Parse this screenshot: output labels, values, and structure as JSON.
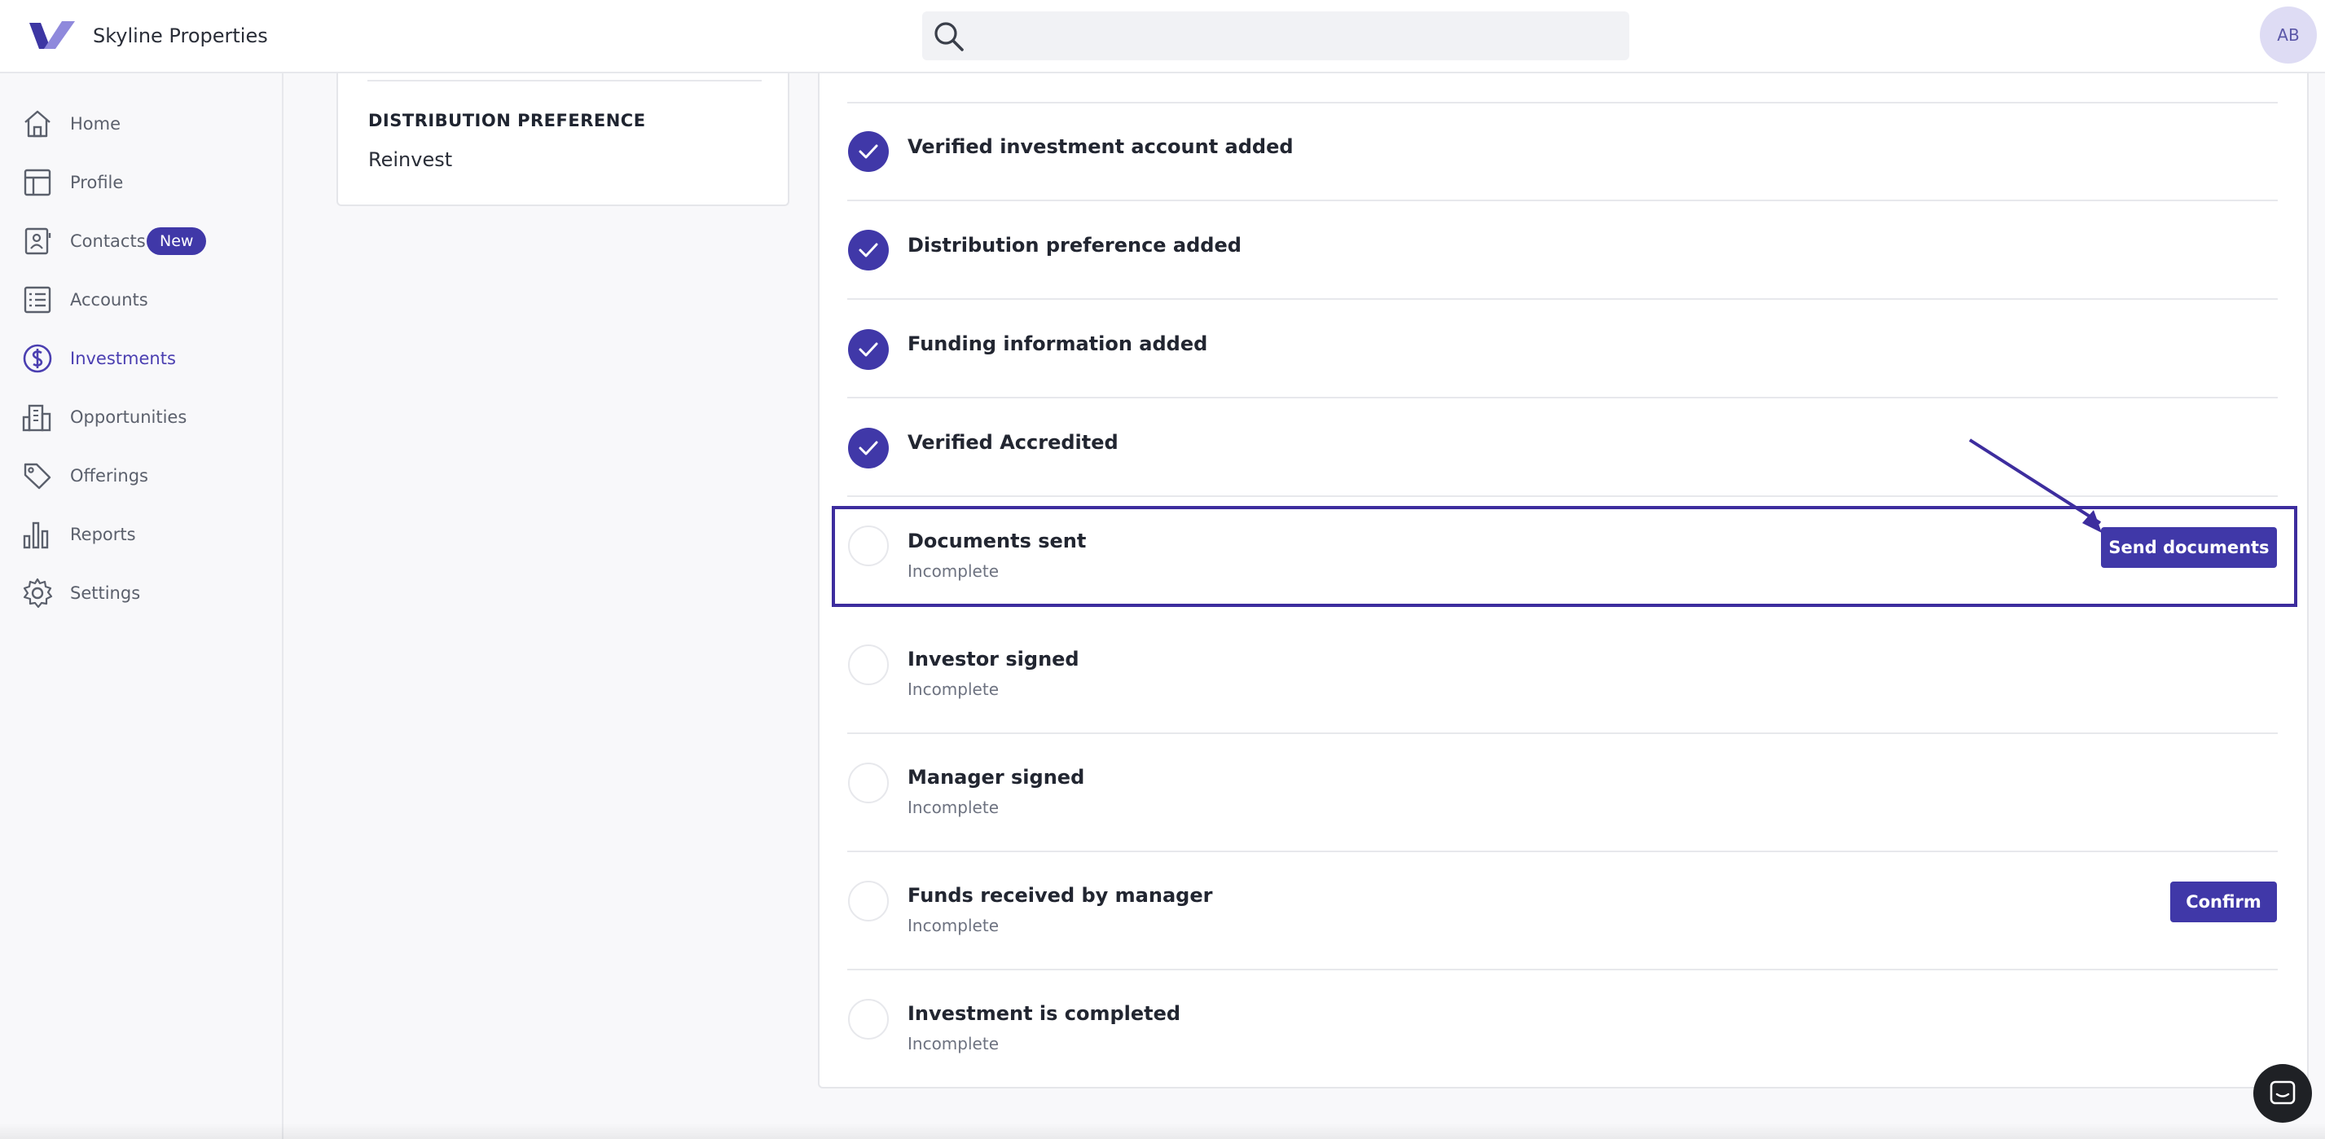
{
  "header": {
    "company_name": "Skyline Properties",
    "search_placeholder": "",
    "avatar_initials": "AB"
  },
  "sidebar": {
    "items": [
      {
        "label": "Home",
        "icon": "home-icon"
      },
      {
        "label": "Profile",
        "icon": "profile-icon"
      },
      {
        "label": "Contacts",
        "icon": "contacts-icon",
        "badge": "New"
      },
      {
        "label": "Accounts",
        "icon": "accounts-icon"
      },
      {
        "label": "Investments",
        "icon": "dollar-icon",
        "active": true
      },
      {
        "label": "Opportunities",
        "icon": "building-icon"
      },
      {
        "label": "Offerings",
        "icon": "tag-icon"
      },
      {
        "label": "Reports",
        "icon": "bar-chart-icon"
      },
      {
        "label": "Settings",
        "icon": "gear-icon"
      }
    ]
  },
  "left_card": {
    "distribution_title": "DISTRIBUTION PREFERENCE",
    "distribution_value": "Reinvest"
  },
  "steps": [
    {
      "title": "Verified investment account added",
      "status": "done"
    },
    {
      "title": "Distribution preference added",
      "status": "done"
    },
    {
      "title": "Funding information added",
      "status": "done"
    },
    {
      "title": "Verified Accredited",
      "status": "done"
    },
    {
      "title": "Documents sent",
      "subtitle": "Incomplete",
      "status": "todo",
      "action": "Send documents"
    },
    {
      "title": "Investor signed",
      "subtitle": "Incomplete",
      "status": "todo"
    },
    {
      "title": "Manager signed",
      "subtitle": "Incomplete",
      "status": "todo"
    },
    {
      "title": "Funds received by manager",
      "subtitle": "Incomplete",
      "status": "todo",
      "action": "Confirm"
    },
    {
      "title": "Investment is completed",
      "subtitle": "Incomplete",
      "status": "todo"
    }
  ],
  "colors": {
    "accent": "#4038a8",
    "highlight": "#3d2d9e"
  }
}
